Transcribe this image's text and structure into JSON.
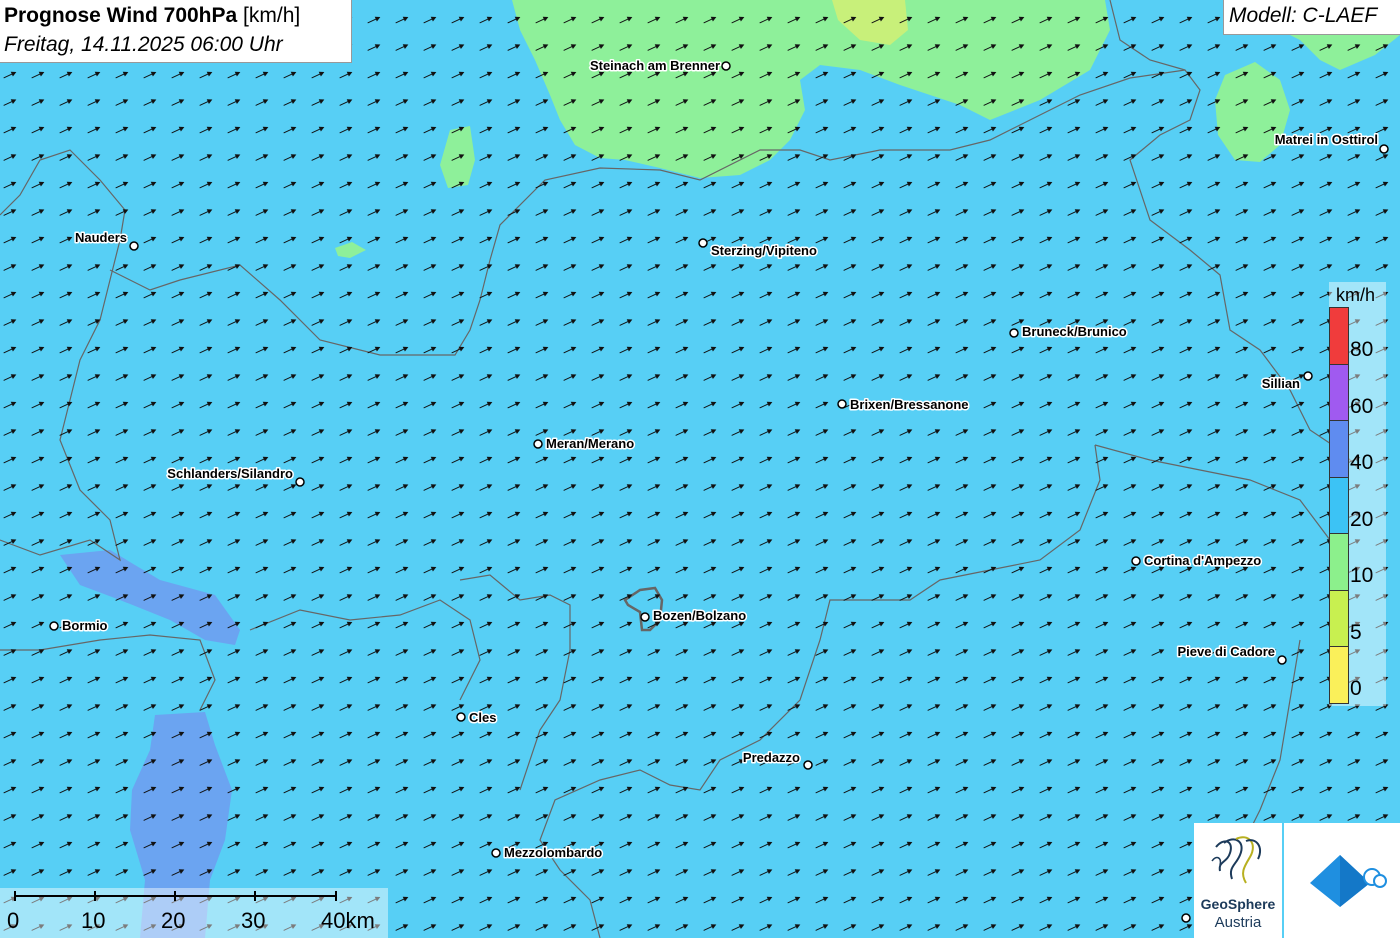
{
  "title": {
    "bold": "Prognose Wind 700hPa",
    "unit": "[km/h]",
    "datetime": "Freitag, 14.11.2025 06:00 Uhr"
  },
  "model": "Modell: C-LAEF",
  "legend": {
    "unit": "km/h",
    "classes": [
      {
        "label": "80",
        "color": "#f03c3c"
      },
      {
        "label": "60",
        "color": "#a05af0"
      },
      {
        "label": "40",
        "color": "#5f8cf0"
      },
      {
        "label": "20",
        "color": "#3cc3f5"
      },
      {
        "label": "10",
        "color": "#8cf08c"
      },
      {
        "label": "5",
        "color": "#c8f050"
      },
      {
        "label": "0",
        "color": "#faf05a"
      }
    ]
  },
  "scalebar": {
    "labels": [
      "0",
      "10",
      "20",
      "30",
      "40km"
    ]
  },
  "cities": [
    {
      "name": "Steinach am Brenner"
    },
    {
      "name": "Matrei in Osttirol"
    },
    {
      "name": "Nauders"
    },
    {
      "name": "Sterzing/Vipiteno"
    },
    {
      "name": "Bruneck/Brunico"
    },
    {
      "name": "Sillian"
    },
    {
      "name": "Brixen/Bressanone"
    },
    {
      "name": "Meran/Merano"
    },
    {
      "name": "Schlanders/Silandro"
    },
    {
      "name": "Cortina d'Ampezzo"
    },
    {
      "name": "Bozen/Bolzano"
    },
    {
      "name": "Bormio"
    },
    {
      "name": "Pieve di Cadore"
    },
    {
      "name": "Cles"
    },
    {
      "name": "Predazzo"
    },
    {
      "name": "Mezzolombardo"
    }
  ],
  "logos": {
    "geosphere_line1": "GeoSphere",
    "geosphere_line2": "Austria"
  },
  "icons": {
    "wind_arrow": "arrow-northeast-icon",
    "city_marker": "circle-marker-icon",
    "logo_right": "diamond-cloud-icon"
  }
}
